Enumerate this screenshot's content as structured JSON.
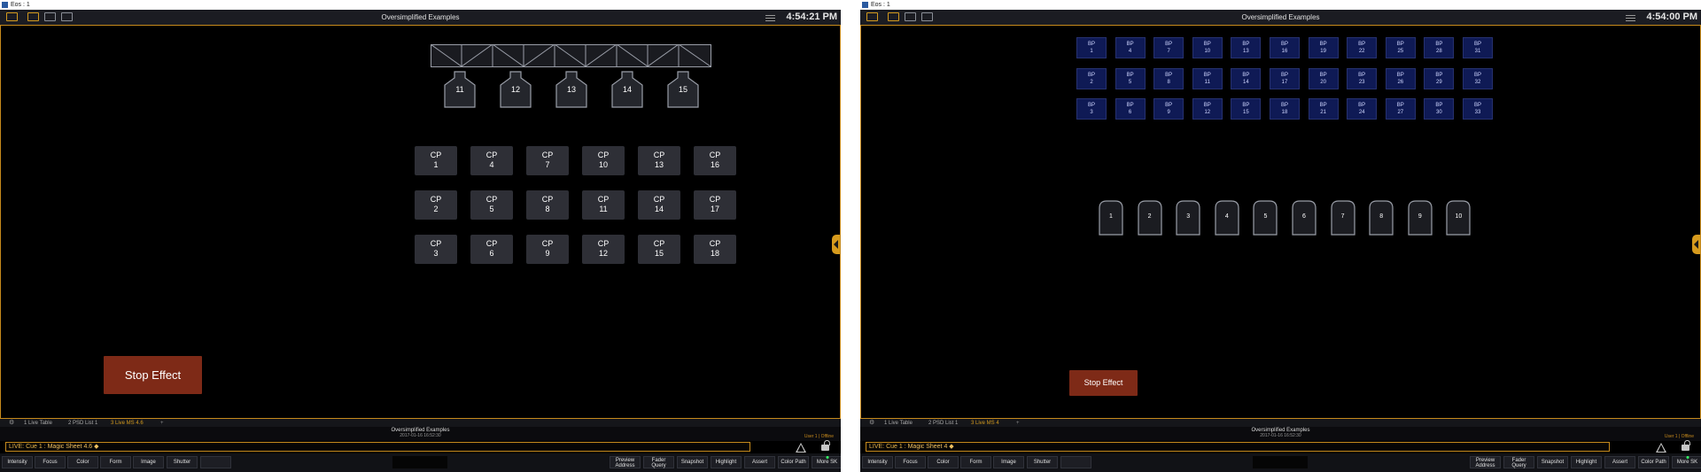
{
  "left": {
    "window_title": "Eos : 1",
    "app_title": "Oversimplified Examples",
    "clock": "4:54:21 PM",
    "lamps": [
      "11",
      "12",
      "13",
      "14",
      "15"
    ],
    "cp_buttons": [
      "CP\n1",
      "CP\n4",
      "CP\n7",
      "CP\n10",
      "CP\n13",
      "CP\n16",
      "CP\n2",
      "CP\n5",
      "CP\n8",
      "CP\n11",
      "CP\n14",
      "CP\n17",
      "CP\n3",
      "CP\n6",
      "CP\n9",
      "CP\n12",
      "CP\n15",
      "CP\n18"
    ],
    "stop_button": "Stop Effect",
    "tabs": [
      "1 Live Table",
      "2 PSD List 1",
      "3 Live MS 4.6",
      "+"
    ],
    "info_title": "Oversimplified Examples",
    "info_date": "2017-01-16 16:52:30",
    "user_status": "User 1 | Offline",
    "command_line": {
      "prefix": "LIVE: Cue  1 :  ",
      "value": "Magic Sheet 4.6"
    },
    "softkeys_left": [
      "Intensity",
      "Focus",
      "Color",
      "Form",
      "Image",
      "Shutter",
      ""
    ],
    "softkeys_right": [
      "Preview\nAddress",
      "Fader\nQuery",
      "Snapshot",
      "Highlight",
      "Assert",
      "Color Path",
      "More SK"
    ]
  },
  "right": {
    "window_title": "Eos : 1",
    "app_title": "Oversimplified Examples",
    "clock": "4:54:00 PM",
    "bp_buttons": [
      "BP\n1",
      "BP\n4",
      "BP\n7",
      "BP\n10",
      "BP\n13",
      "BP\n16",
      "BP\n19",
      "BP\n22",
      "BP\n25",
      "BP\n28",
      "BP\n31",
      "BP\n2",
      "BP\n5",
      "BP\n8",
      "BP\n11",
      "BP\n14",
      "BP\n17",
      "BP\n20",
      "BP\n23",
      "BP\n26",
      "BP\n29",
      "BP\n32",
      "BP\n3",
      "BP\n6",
      "BP\n9",
      "BP\n12",
      "BP\n15",
      "BP\n18",
      "BP\n21",
      "BP\n24",
      "BP\n27",
      "BP\n30",
      "BP\n33"
    ],
    "drums": [
      "1",
      "2",
      "3",
      "4",
      "5",
      "6",
      "7",
      "8",
      "9",
      "10"
    ],
    "stop_button": "Stop Effect",
    "tabs": [
      "1 Live Table",
      "2 PSD List 1",
      "3 Live MS 4",
      "+"
    ],
    "info_title": "Oversimplified Examples",
    "info_date": "2017-01-16 16:52:30",
    "user_status": "User 1 | Offline",
    "command_line": {
      "prefix": "LIVE: Cue  1 :  ",
      "value": "Magic Sheet 4"
    },
    "softkeys_left": [
      "Intensity",
      "Focus",
      "Color",
      "Form",
      "Image",
      "Shutter",
      ""
    ],
    "softkeys_right": [
      "Preview\nAddress",
      "Fader\nQuery",
      "Snapshot",
      "Highlight",
      "Assert",
      "Color Path",
      "More SK"
    ]
  },
  "colors": {
    "accent": "#c68a1c",
    "stop_button": "#7e2a17",
    "cp_button": "#2e2f36",
    "bp_button": "#0f1a55"
  }
}
